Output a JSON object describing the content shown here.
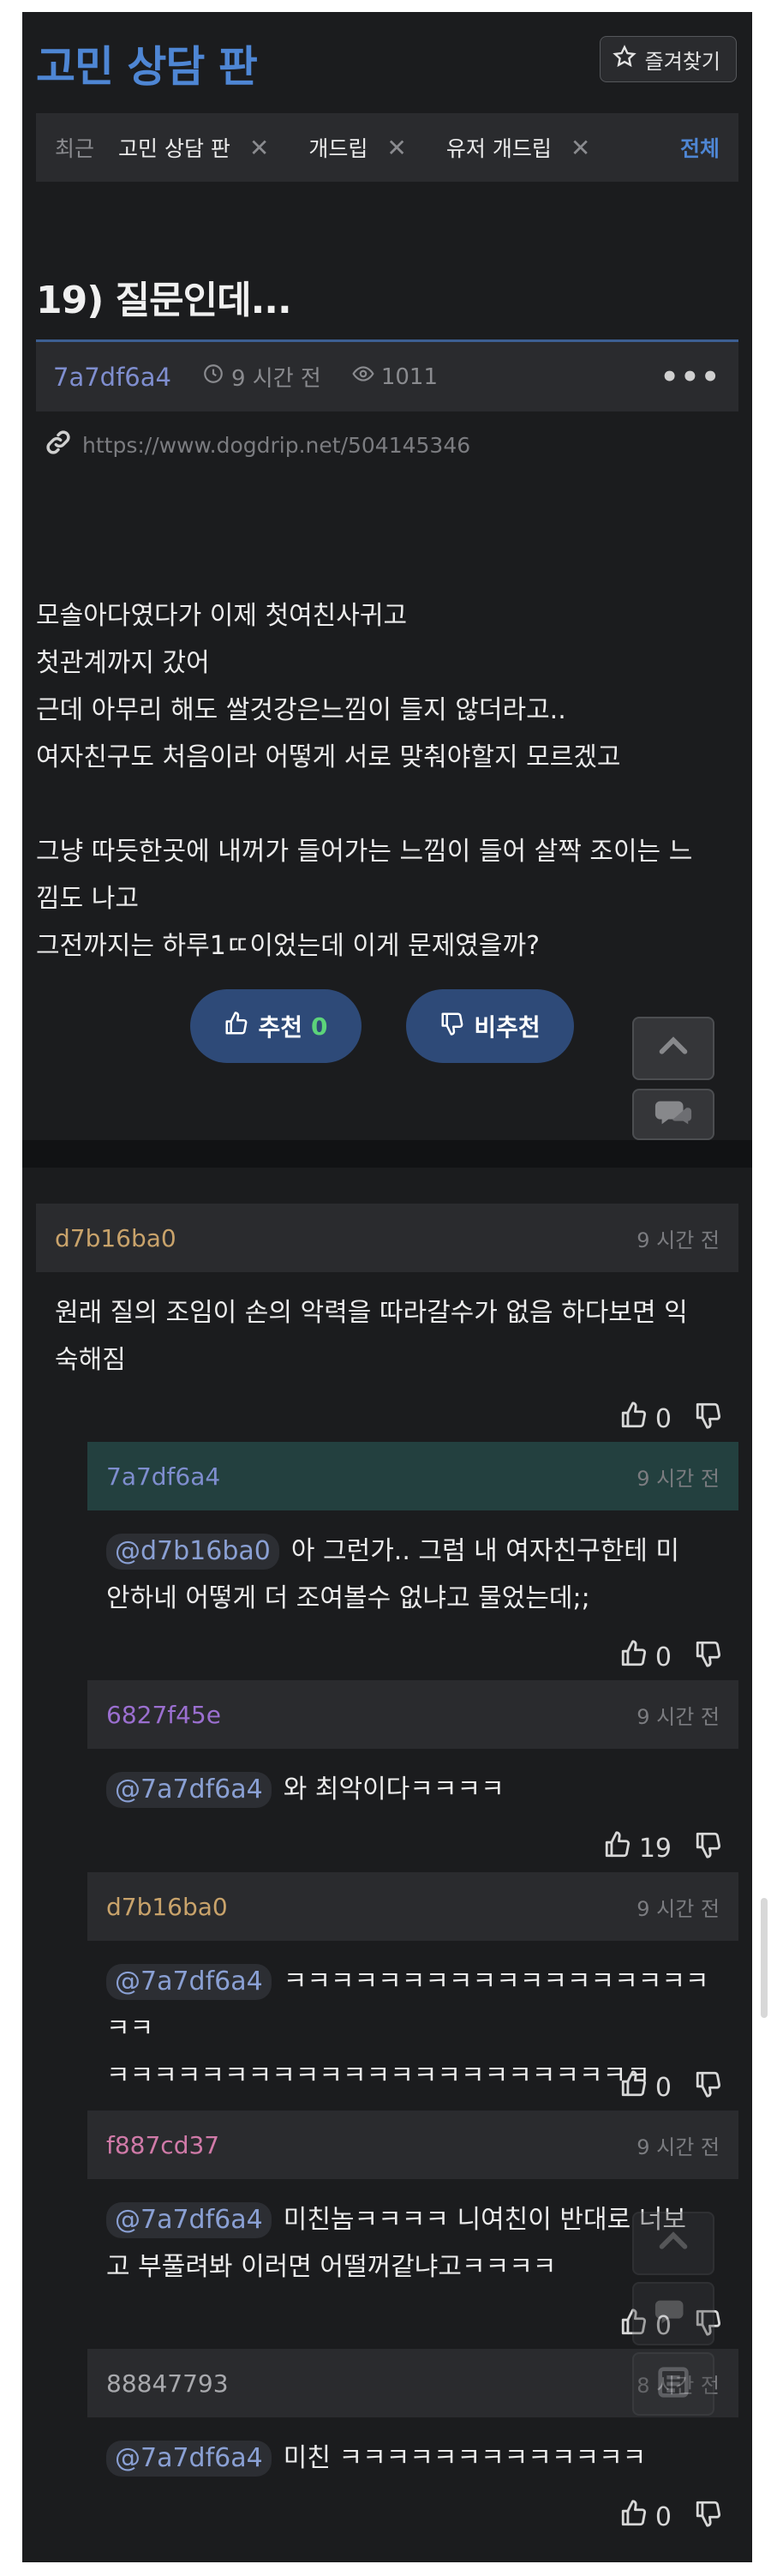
{
  "board": {
    "title": "고민 상담 판",
    "favorite_label": "즐겨찾기"
  },
  "recent": {
    "label": "최근",
    "tabs": [
      "고민 상담 판",
      "개드립",
      "유저 개드립"
    ],
    "all_label": "전체"
  },
  "post": {
    "title": "19) 질문인데...",
    "author": "7a7df6a4",
    "time": "9 시간 전",
    "views": "1011",
    "more": "•••",
    "url": "https://www.dogdrip.net/504145346",
    "body_lines": [
      "",
      "",
      "",
      "",
      "",
      "",
      "",
      "모솔아다였다가 이제 첫여친사귀고",
      "첫관계까지 갔어",
      "근데 아무리 해도 쌀것강은느낌이  들지 않더라고..",
      "여자친구도 처음이라 어떻게 서로 맞춰야할지 모르겠고",
      "",
      "그냥 따듯한곳에 내꺼가 들어가는 느낌이 들어 살짝 조이는 느",
      "낌도 나고",
      "그전까지는 하루1ㄸ이었는데 이게 문제였을까?"
    ],
    "upvote_label": "추천",
    "upvote_count": "0",
    "downvote_label": "비추천"
  },
  "comments": [
    {
      "author": "d7b16ba0",
      "author_color": "#c9a36b",
      "time": "9 시간 전",
      "mention": "",
      "lines": [
        "원래 질의 조임이 손의 악력을 따라갈수가 없음 하다보면 익",
        "숙해짐"
      ],
      "likes": "0",
      "op": false
    },
    {
      "author": "7a7df6a4",
      "author_color": "#7f8ecf",
      "time": "9 시간 전",
      "mention": "@d7b16ba0",
      "lines": [
        "아 그런가.. 그럼 내 여자친구한테 미",
        "안하네 어떻게 더 조여볼수 없냐고 물었는데;;"
      ],
      "likes": "0",
      "op": true
    },
    {
      "author": "6827f45e",
      "author_color": "#9b6fd0",
      "time": "9 시간 전",
      "mention": "@7a7df6a4",
      "lines": [
        "와 최악이다ㅋㅋㅋㅋ"
      ],
      "likes": "19",
      "op": false
    },
    {
      "author": "d7b16ba0",
      "author_color": "#c9a36b",
      "time": "9 시간 전",
      "mention": "@7a7df6a4",
      "lines": [
        "ㅋㅋㅋㅋㅋㅋㅋㅋㅋㅋㅋㅋㅋㅋㅋㅋㅋㅋㅋㅋ",
        "ㅋㅋㅋㅋㅋㅋㅋㅋㅋㅋㅋㅋㅋㅋㅋㅋㅋㅋㅋㅋㅋㅋㅋ"
      ],
      "likes": "0",
      "op": false
    },
    {
      "author": "f887cd37",
      "author_color": "#d07aa8",
      "time": "9 시간 전",
      "mention": "@7a7df6a4",
      "lines": [
        "미친놈ㅋㅋㅋㅋ 니여친이 반대로 너보",
        "고 부풀려봐 이러면 어떨꺼같냐고ㅋㅋㅋㅋ"
      ],
      "likes": "0",
      "op": false
    },
    {
      "author": "88847793",
      "author_color": "#a8a9ad",
      "time": "8 시간 전",
      "mention": "@7a7df6a4",
      "lines": [
        "미친 ㅋㅋㅋㅋㅋㅋㅋㅋㅋㅋㅋㅋㅋ"
      ],
      "likes": "0",
      "op": false
    }
  ],
  "colors": {
    "accent": "#4e86d4",
    "background": "#1b1c1e",
    "panel": "#2a2b2e",
    "upvote_count": "#5cd37a"
  },
  "icons": [
    "star-icon",
    "close-icon",
    "clock-icon",
    "eye-icon",
    "link-icon",
    "thumbs-up-icon",
    "thumbs-down-icon",
    "chevron-up-icon",
    "comment-icon",
    "list-icon"
  ]
}
